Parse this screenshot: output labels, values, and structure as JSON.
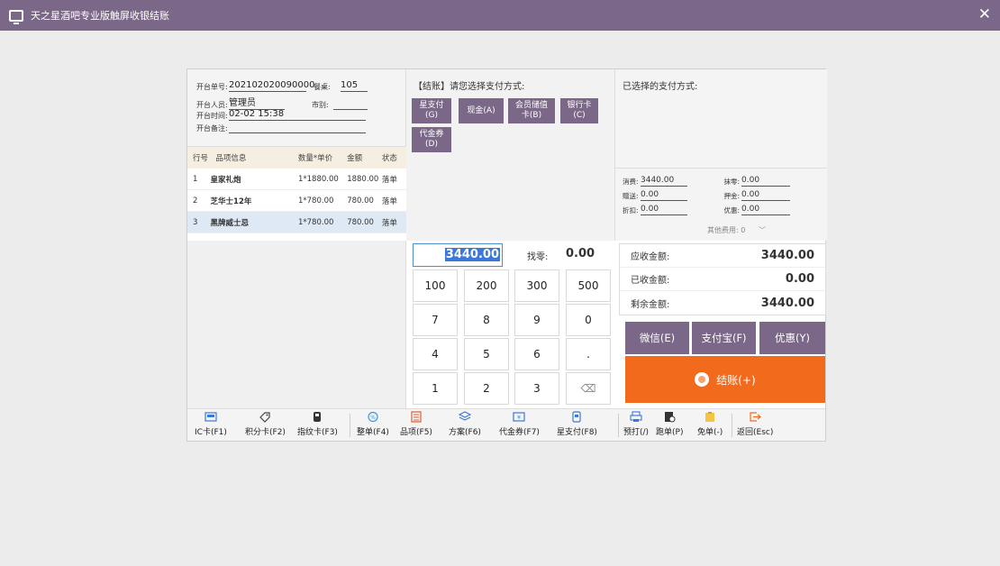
{
  "window": {
    "title": "天之星酒吧专业版触屏收银结账",
    "close_label": "✕"
  },
  "order": {
    "order_no_label": "开台单号:",
    "order_no": "202102020090000",
    "table_label": "餐桌:",
    "table": "105",
    "staff_label": "开台人员:",
    "staff": "管理员",
    "market_label": "市别:",
    "market": "",
    "time_label": "开台时间:",
    "time": "02-02 15:38",
    "remark_label": "开台备注:",
    "remark": ""
  },
  "items_table": {
    "headers": [
      "行号",
      "品项信息",
      "数量*单价",
      "金额",
      "状态"
    ],
    "rows": [
      {
        "no": "1",
        "name": "皇家礼炮",
        "qty_price": "1*1880.00",
        "amount": "1880.00",
        "status": "落单"
      },
      {
        "no": "2",
        "name": "芝华士12年",
        "qty_price": "1*780.00",
        "amount": "780.00",
        "status": "落单"
      },
      {
        "no": "3",
        "name": "黑牌威士忌",
        "qty_price": "1*780.00",
        "amount": "780.00",
        "status": "落单"
      }
    ]
  },
  "payment_select": {
    "header": "【结账】请您选择支付方式:",
    "methods": [
      "星支付\n(G)",
      "现金(A)",
      "会员储值\n卡(B)",
      "银行卡\n(C)",
      "代金券\n(D)"
    ]
  },
  "chosen": {
    "header": "已选择的支付方式:"
  },
  "fees": {
    "consume_label": "消费:",
    "consume": "3440.00",
    "round_label": "抹零:",
    "round": "0.00",
    "gift_label": "赠送:",
    "gift": "0.00",
    "deposit_label": "押金:",
    "deposit": "0.00",
    "discount_label": "折扣:",
    "discount": "0.00",
    "promo_label": "优惠:",
    "promo": "0.00",
    "other": "其他费用: 0"
  },
  "keypad": {
    "amount": "3440.00",
    "change_label": "找零:",
    "change": "0.00",
    "keys": [
      "100",
      "200",
      "300",
      "500",
      "7",
      "8",
      "9",
      "0",
      "4",
      "5",
      "6",
      ".",
      "1",
      "2",
      "3",
      "⌫"
    ]
  },
  "totals": {
    "receivable_label": "应收金额:",
    "receivable": "3440.00",
    "received_label": "已收金额:",
    "received": "0.00",
    "remaining_label": "剩余金额:",
    "remaining": "3440.00"
  },
  "quick_pay": {
    "wechat": "微信(E)",
    "alipay": "支付宝(F)",
    "discount": "优惠(Y)"
  },
  "checkout_label": "结账(+)",
  "toolbar": {
    "items": [
      "IC卡(F1)",
      "积分卡(F2)",
      "指纹卡(F3)",
      "整单(F4)",
      "品项(F5)",
      "方案(F6)",
      "代金券(F7)",
      "星支付(F8)",
      "预打(/)",
      "跑单(P)",
      "免单(-)",
      "返回(Esc)"
    ]
  },
  "colors": {
    "titlebar": "#7b6787",
    "purple_button": "#7b6787",
    "checkout": "#f26b1d",
    "selection": "#3b78d8"
  }
}
